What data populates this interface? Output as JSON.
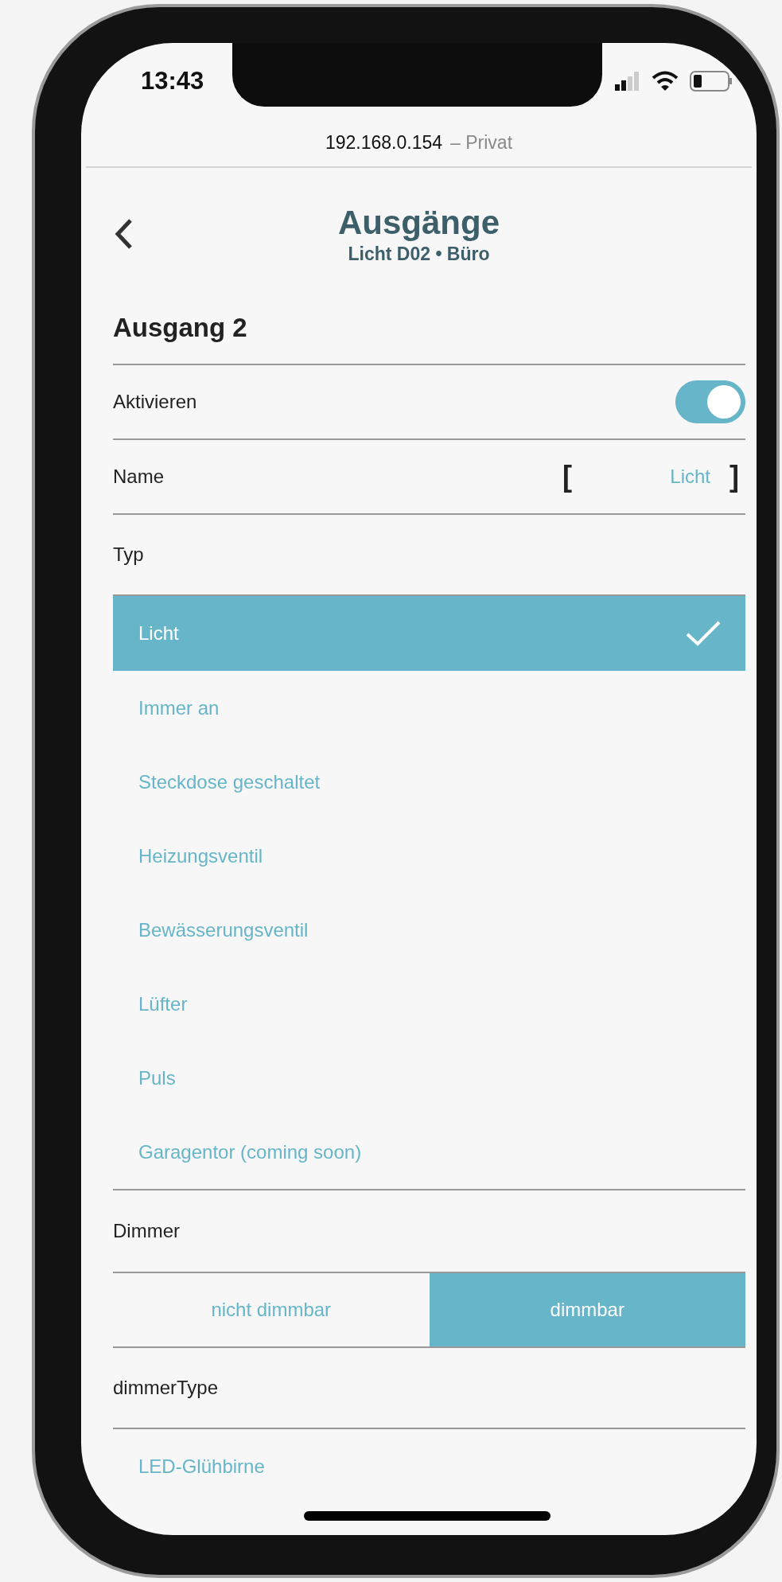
{
  "status_bar": {
    "time": "13:43"
  },
  "browser": {
    "address": "192.168.0.154",
    "mode": "– Privat"
  },
  "header": {
    "title": "Ausgänge",
    "subtitle": "Licht D02 • Büro"
  },
  "section": {
    "title": "Ausgang 2"
  },
  "fields": [
    {
      "kind": "toggle",
      "label": "Aktivieren",
      "on": true
    },
    {
      "kind": "text",
      "label": "Name",
      "value": "Licht",
      "brackets": [
        "[",
        "]"
      ]
    },
    {
      "kind": "choice",
      "label": "Typ",
      "options": [
        {
          "label": "Licht",
          "selected": true
        },
        {
          "label": "Immer an",
          "selected": false
        },
        {
          "label": "Steckdose geschaltet",
          "selected": false
        },
        {
          "label": "Heizungsventil",
          "selected": false
        },
        {
          "label": "Bewässerungsventil",
          "selected": false
        },
        {
          "label": "Lüfter",
          "selected": false
        },
        {
          "label": "Puls",
          "selected": false
        },
        {
          "label": "Garagentor (coming soon)",
          "selected": false
        }
      ]
    },
    {
      "kind": "segmented",
      "label": "Dimmer",
      "options": [
        {
          "label": "nicht dimmbar",
          "selected": false
        },
        {
          "label": "dimmbar",
          "selected": true
        }
      ]
    },
    {
      "kind": "choice",
      "label": "dimmerType",
      "options": [
        {
          "label": "LED-Glühbirne",
          "selected": false
        }
      ]
    }
  ]
}
